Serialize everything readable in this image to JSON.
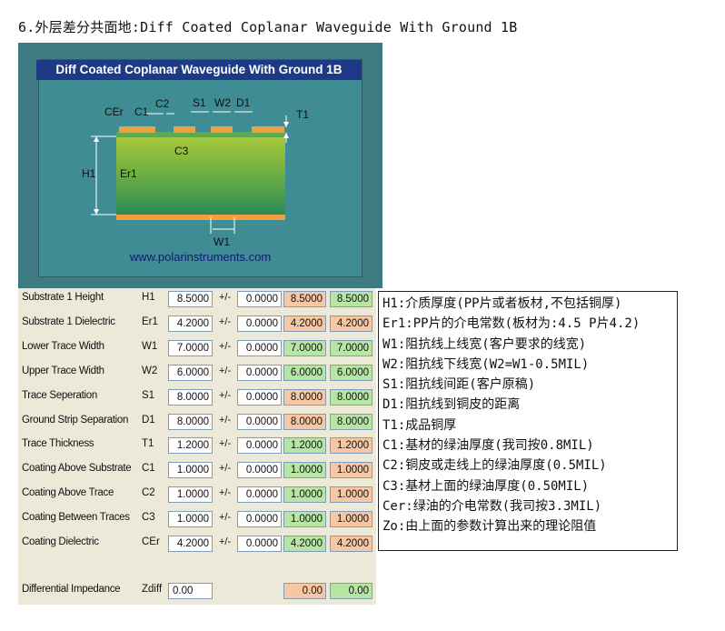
{
  "heading": "6.外层差分共面地:Diff Coated Coplanar Waveguide With Ground 1B",
  "diagram": {
    "title": "Diff Coated Coplanar Waveguide With Ground 1B",
    "url": "www.polarinstruments.com",
    "labels": {
      "cer": "CEr",
      "c1": "C1",
      "c2": "C2",
      "s1": "S1",
      "w2": "W2",
      "d1": "D1",
      "t1": "T1",
      "c3": "C3",
      "h1": "H1",
      "er1": "Er1",
      "w1": "W1"
    },
    "colors": {
      "frame": "#3d7a82",
      "title_bg": "#1e3a86",
      "conductor": "#f0a03c",
      "coating": "#5faa4a",
      "substrate_top": "#8fc240",
      "substrate_bottom": "#2f8a4e"
    }
  },
  "rows": [
    {
      "name": "Substrate 1 Height",
      "sym": "H1",
      "value": "8.5000",
      "pm": "+/-",
      "tol": "0.0000",
      "min": "8.5000",
      "max": "8.5000",
      "min_color": "#f7c7a3",
      "max_color": "#b7e6a4"
    },
    {
      "name": "Substrate 1 Dielectric",
      "sym": "Er1",
      "value": "4.2000",
      "pm": "+/-",
      "tol": "0.0000",
      "min": "4.2000",
      "max": "4.2000",
      "min_color": "#f7c7a3",
      "max_color": "#f7c7a3"
    },
    {
      "name": "Lower Trace Width",
      "sym": "W1",
      "value": "7.0000",
      "pm": "+/-",
      "tol": "0.0000",
      "min": "7.0000",
      "max": "7.0000",
      "min_color": "#b7e6a4",
      "max_color": "#b7e6a4"
    },
    {
      "name": "Upper Trace Width",
      "sym": "W2",
      "value": "6.0000",
      "pm": "+/-",
      "tol": "0.0000",
      "min": "6.0000",
      "max": "6.0000",
      "min_color": "#b7e6a4",
      "max_color": "#b7e6a4"
    },
    {
      "name": "Trace Seperation",
      "sym": "S1",
      "value": "8.0000",
      "pm": "+/-",
      "tol": "0.0000",
      "min": "8.0000",
      "max": "8.0000",
      "min_color": "#f7c7a3",
      "max_color": "#b7e6a4"
    },
    {
      "name": "Ground Strip Separation",
      "sym": "D1",
      "value": "8.0000",
      "pm": "+/-",
      "tol": "0.0000",
      "min": "8.0000",
      "max": "8.0000",
      "min_color": "#f7c7a3",
      "max_color": "#b7e6a4"
    },
    {
      "name": "Trace Thickness",
      "sym": "T1",
      "value": "1.2000",
      "pm": "+/-",
      "tol": "0.0000",
      "min": "1.2000",
      "max": "1.2000",
      "min_color": "#b7e6a4",
      "max_color": "#f7c7a3"
    },
    {
      "name": "Coating Above Substrate",
      "sym": "C1",
      "value": "1.0000",
      "pm": "+/-",
      "tol": "0.0000",
      "min": "1.0000",
      "max": "1.0000",
      "min_color": "#b7e6a4",
      "max_color": "#f7c7a3"
    },
    {
      "name": "Coating Above Trace",
      "sym": "C2",
      "value": "1.0000",
      "pm": "+/-",
      "tol": "0.0000",
      "min": "1.0000",
      "max": "1.0000",
      "min_color": "#b7e6a4",
      "max_color": "#f7c7a3"
    },
    {
      "name": "Coating Between Traces",
      "sym": "C3",
      "value": "1.0000",
      "pm": "+/-",
      "tol": "0.0000",
      "min": "1.0000",
      "max": "1.0000",
      "min_color": "#b7e6a4",
      "max_color": "#f7c7a3"
    },
    {
      "name": "Coating Dielectric",
      "sym": "CEr",
      "value": "4.2000",
      "pm": "+/-",
      "tol": "0.0000",
      "min": "4.2000",
      "max": "4.2000",
      "min_color": "#b7e6a4",
      "max_color": "#f7c7a3"
    }
  ],
  "impedance": {
    "name": "Differential Impedance",
    "sym": "Zdiff",
    "value": "0.00",
    "min": "0.00",
    "max": "0.00",
    "min_color": "#f7c7a3",
    "max_color": "#b7e6a4"
  },
  "legend": [
    "H1:介质厚度(PP片或者板材,不包括铜厚)",
    "Er1:PP片的介电常数(板材为:4.5 P片4.2)",
    "W1:阻抗线上线宽(客户要求的线宽)",
    "W2:阻抗线下线宽(W2=W1-0.5MIL)",
    "S1:阻抗线间距(客户原稿)",
    "D1:阻抗线到铜皮的距离",
    "T1:成品铜厚",
    "C1:基材的绿油厚度(我司按0.8MIL)",
    "C2:铜皮或走线上的绿油厚度(0.5MIL)",
    "C3:基材上面的绿油厚度(0.50MIL)",
    "Cer:绿油的介电常数(我司按3.3MIL)",
    "Zo:由上面的参数计算出来的理论阻值"
  ]
}
